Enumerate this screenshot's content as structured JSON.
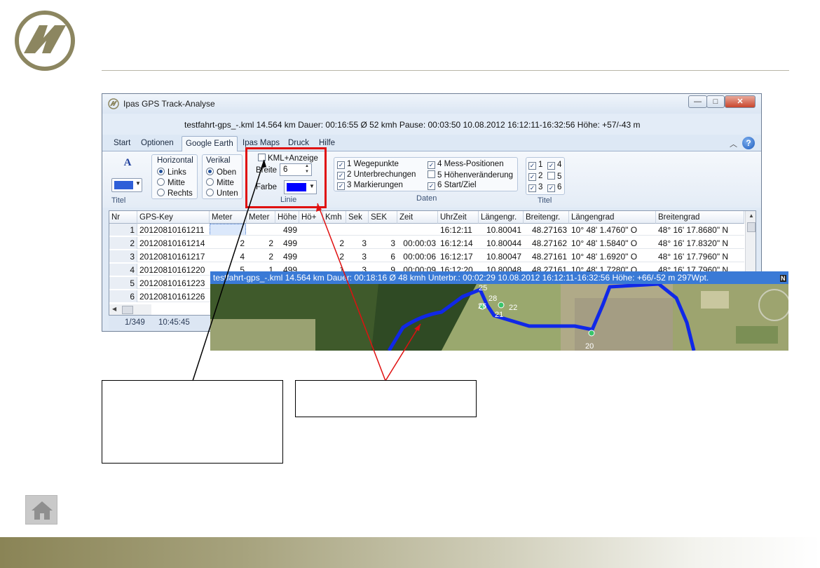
{
  "window": {
    "title": "Ipas GPS Track-Analyse",
    "info": "testfahrt-gps_-.kml  14.564 km  Dauer: 00:16:55  Ø 52 kmh  Pause: 00:03:50  10.08.2012 16:12:11-16:32:56   Höhe: +57/-43 m",
    "min_glyph": "—",
    "max_glyph": "□",
    "close_glyph": "✕"
  },
  "tabs": [
    "Start",
    "Optionen",
    "Google Earth",
    "Ipas Maps",
    "Druck",
    "Hilfe"
  ],
  "active_tab_index": 2,
  "ribbon": {
    "titel_group": {
      "label": "Titel",
      "font_glyph": "A",
      "color": "#2f5fd8"
    },
    "horizontal": {
      "label": "Horizontal",
      "options": [
        "Links",
        "Mitte",
        "Rechts"
      ],
      "selected": 0
    },
    "vertical": {
      "label": "Verikal",
      "options": [
        "Oben",
        "Mitte",
        "Unten"
      ],
      "selected": 0
    },
    "linie": {
      "label": "Linie",
      "kml_label": "KML+Anzeige",
      "breite_label": "Breite",
      "breite_value": "6",
      "farbe_label": "Farbe",
      "farbe_color": "#0000ff"
    },
    "daten": {
      "label": "Daten",
      "items": [
        {
          "label": "1 Wegepunkte",
          "checked": true
        },
        {
          "label": "2 Unterbrechungen",
          "checked": true
        },
        {
          "label": "3 Markierungen",
          "checked": true
        },
        {
          "label": "4 Mess-Positionen",
          "checked": true
        },
        {
          "label": "5 Höhenveränderung",
          "checked": false
        },
        {
          "label": "6 Start/Ziel",
          "checked": true
        }
      ]
    },
    "titel_checks": {
      "label": "Titel",
      "items": [
        {
          "label": "1",
          "checked": true
        },
        {
          "label": "4",
          "checked": true
        },
        {
          "label": "2",
          "checked": true
        },
        {
          "label": "5",
          "checked": false
        },
        {
          "label": "3",
          "checked": true
        },
        {
          "label": "6",
          "checked": true
        }
      ]
    }
  },
  "table": {
    "columns": [
      "Nr",
      "GPS-Key",
      "Meter",
      "Meter",
      "Höhe",
      "Hö+",
      "Kmh",
      "Sek",
      "SEK",
      "Zeit",
      "UhrZeit",
      "Längengr.",
      "Breitengr.",
      "Längengrad",
      "Breitengrad"
    ],
    "rows": [
      [
        "1",
        "20120810161211",
        "",
        "",
        "499",
        "",
        "",
        "",
        "",
        "",
        "16:12:11",
        "10.80041",
        "48.27163",
        "10° 48' 1.4760\" O",
        "48° 16' 17.8680\" N"
      ],
      [
        "2",
        "20120810161214",
        "2",
        "2",
        "499",
        "",
        "2",
        "3",
        "3",
        "00:00:03",
        "16:12:14",
        "10.80044",
        "48.27162",
        "10° 48' 1.5840\" O",
        "48° 16' 17.8320\" N"
      ],
      [
        "3",
        "20120810161217",
        "4",
        "2",
        "499",
        "",
        "2",
        "3",
        "6",
        "00:00:06",
        "16:12:17",
        "10.80047",
        "48.27161",
        "10° 48' 1.6920\" O",
        "48° 16' 17.7960\" N"
      ],
      [
        "4",
        "20120810161220",
        "5",
        "1",
        "499",
        "",
        "1",
        "3",
        "9",
        "00:00:09",
        "16:12:20",
        "10.80048",
        "48.27161",
        "10° 48' 1.7280\" O",
        "48° 16' 17.7960\" N"
      ],
      [
        "5",
        "20120810161223",
        "",
        "",
        "",
        "",
        "",
        "",
        "",
        "",
        "",
        "",
        "",
        "",
        ""
      ],
      [
        "6",
        "20120810161226",
        "",
        "",
        "",
        "",
        "",
        "",
        "",
        "",
        "",
        "",
        "",
        "",
        ""
      ]
    ]
  },
  "status": {
    "position": "1/349",
    "time": "10:45:45"
  },
  "map": {
    "bar_text": "testfahrt-gps_-.kml  14.564 km  Dauer: 00:18:16  Ø 48 kmh  Unterbr.: 00:02:29  10.08.2012 16:12:11-16:32:56   Höhe: +66/-52 m  297Wpt.",
    "north": "N",
    "markers": [
      "25",
      "26",
      "28",
      "22",
      "21",
      "20"
    ],
    "track_color": "#1028e8"
  },
  "colors": {
    "highlight": "#e01010",
    "footer_olive": "#8a8456",
    "logo": "#8c8660"
  }
}
